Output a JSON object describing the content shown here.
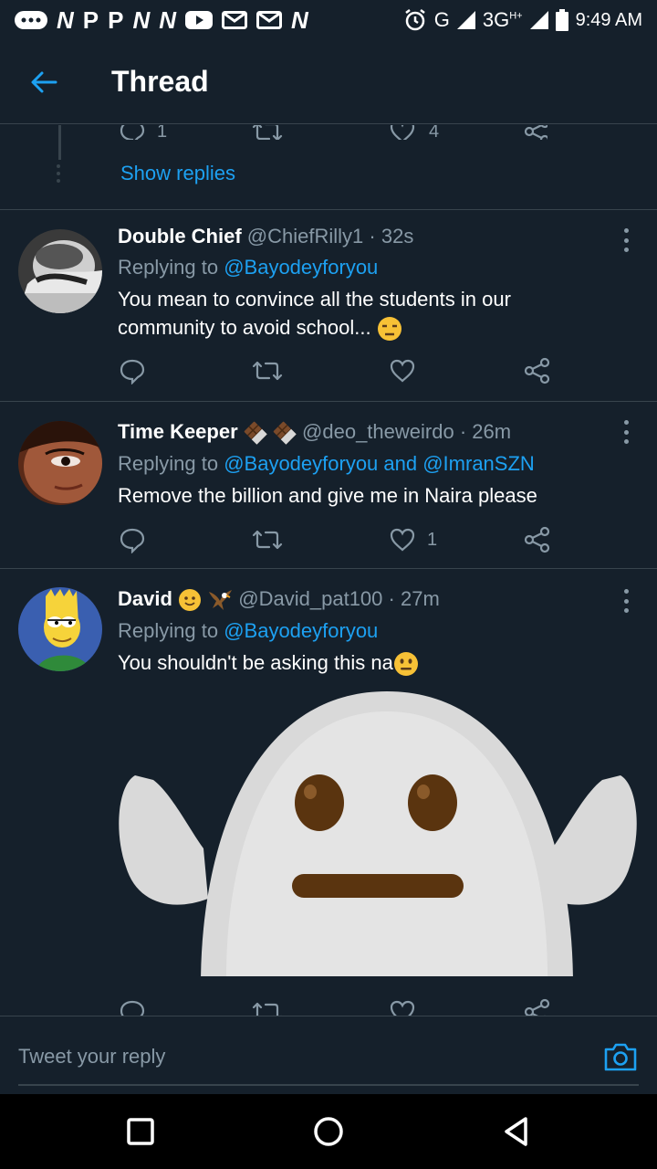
{
  "status_bar": {
    "time": "9:49 AM",
    "network_g": "G",
    "network_3g": "3G",
    "network_3g_sup": "H+",
    "notification_icons": [
      "...",
      "N",
      "P",
      "P",
      "N",
      "N",
      "youtube",
      "gmail",
      "gmail",
      "N"
    ]
  },
  "header": {
    "title": "Thread"
  },
  "previous_tweet": {
    "reply_count": "1",
    "like_count": "4",
    "show_replies_label": "Show replies"
  },
  "tweets": [
    {
      "name": "Double Chief",
      "handle": "@ChiefRilly1",
      "time": "· 32s",
      "replying_prefix": "Replying to",
      "replying_to": "@Bayodeyforyou",
      "text": "You mean to convince all the students in our community to avoid school...",
      "like_count": ""
    },
    {
      "name": "Time Keeper",
      "handle": "@deo_theweirdo",
      "time": "· 26m",
      "replying_prefix": "Replying to",
      "replying_to": "@Bayodeyforyou and @ImranSZN",
      "text": "Remove the billion and give me in Naira please",
      "like_count": "1"
    },
    {
      "name": "David",
      "handle": "@David_pat100",
      "time": "· 27m",
      "replying_prefix": "Replying to",
      "replying_to": "@Bayodeyforyou",
      "text": "You shouldn't be asking this na",
      "like_count": ""
    }
  ],
  "composer": {
    "placeholder": "Tweet your reply"
  },
  "colors": {
    "background": "#15202b",
    "accent": "#1da1f2",
    "secondary_text": "#8899a6",
    "divider": "#38444d"
  },
  "icons": {
    "back": "arrow-left-icon",
    "reply": "comment-icon",
    "retweet": "retweet-icon",
    "like": "heart-icon",
    "share": "share-icon",
    "more": "more-vertical-icon",
    "camera": "camera-icon"
  }
}
